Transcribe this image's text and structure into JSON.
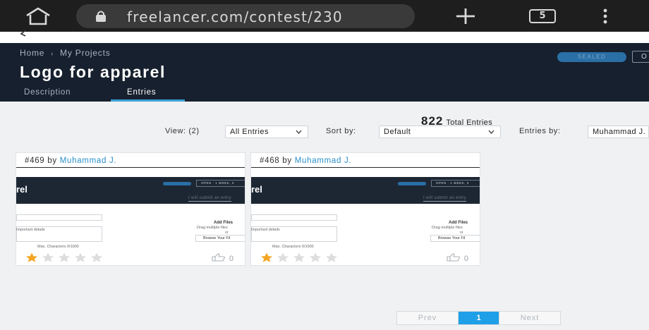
{
  "browser": {
    "url": "freelancer.com/contest/230",
    "tab_count": "5",
    "icons": {
      "home": "home-icon",
      "lock": "lock-icon",
      "new_tab": "plus-icon",
      "menu": "kebab-menu-icon"
    }
  },
  "header": {
    "breadcrumbs": [
      "Home",
      "My Projects"
    ],
    "title": "Logo for apparel",
    "sealed_badge": "SEALED",
    "status_partial": "O",
    "tabs": [
      {
        "label": "Description",
        "active": false
      },
      {
        "label": "Entries",
        "active": true
      }
    ]
  },
  "toolbar": {
    "total_count": "822",
    "total_label": "Total Entries",
    "view_label": "View: (2)",
    "view_value": "All Entries",
    "sort_label": "Sort by:",
    "sort_value": "Default",
    "entries_by_label": "Entries by:",
    "entries_by_value": "Muhammad J."
  },
  "entries": [
    {
      "caption_prefix": "#469 by",
      "author": "Muhammad J.",
      "rating": 1,
      "likes": "0",
      "thumbnail": {
        "title_fragment": "rel",
        "status": "OPEN · 1 WEEK, 3",
        "submit_link": "I will submit an entry",
        "important": "Important details",
        "max_chars": "Max. Characters 0/1000",
        "add_files": "Add Files",
        "drag": "Drag multiple files",
        "or": "or",
        "browse": "Browse Your Fil"
      }
    },
    {
      "caption_prefix": "#468 by",
      "author": "Muhammad J.",
      "rating": 1,
      "likes": "0",
      "thumbnail": {
        "title_fragment": "rel",
        "status": "OPEN · 1 WEEK, 3",
        "submit_link": "I will submit an entry",
        "important": "Important details",
        "max_chars": "Max. Characters 0/1000",
        "add_files": "Add Files",
        "drag": "Drag multiple files",
        "or": "or",
        "browse": "Browse Your Fil"
      }
    }
  ],
  "pagination": {
    "prev": "Prev",
    "current": "1",
    "next": "Next"
  },
  "colors": {
    "header_bg": "#17202e",
    "accent_blue": "#1f9fe8",
    "link_blue": "#2a8fc9",
    "star_filled": "#f5a623",
    "star_empty": "#dddddd"
  }
}
